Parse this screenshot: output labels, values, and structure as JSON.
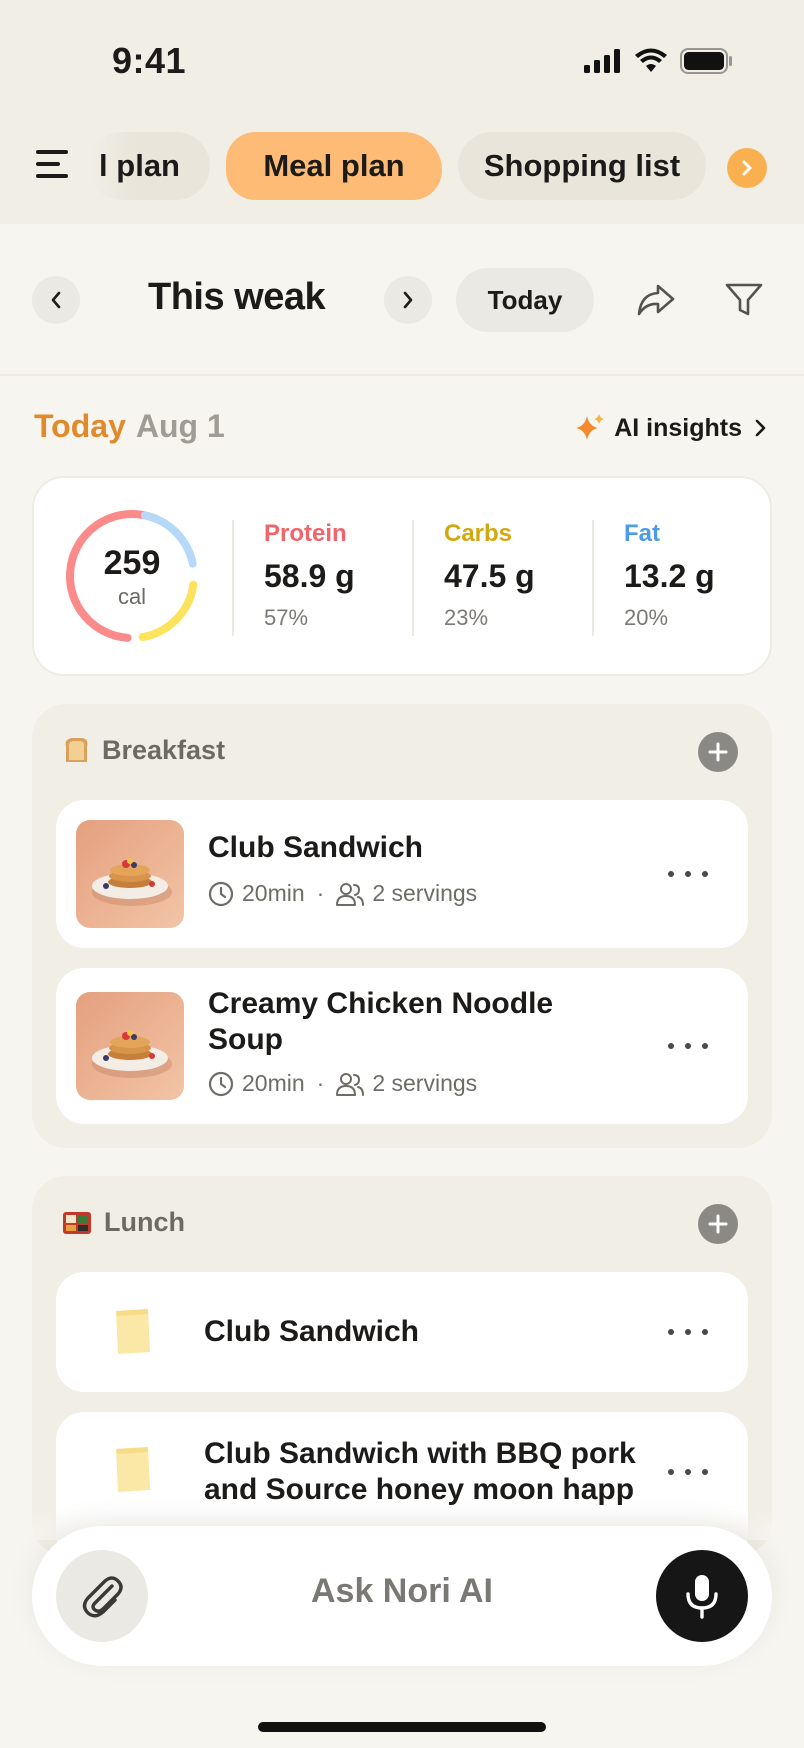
{
  "status_bar": {
    "time": "9:41"
  },
  "tabs": [
    {
      "label": "l plan"
    },
    {
      "label": "Meal plan",
      "active": true
    },
    {
      "label": "Shopping list"
    }
  ],
  "week_bar": {
    "title": "This weak",
    "today_button": "Today"
  },
  "day": {
    "today_label": "Today",
    "date": "Aug 1",
    "ai_insights": "AI insights"
  },
  "macros": {
    "calories": {
      "value": "259",
      "unit": "cal"
    },
    "items": [
      {
        "name": "Protein",
        "value": "58.9 g",
        "percent": "57%",
        "color": "#f0646a"
      },
      {
        "name": "Carbs",
        "value": "47.5 g",
        "percent": "23%",
        "color": "#d1a90f"
      },
      {
        "name": "Fat",
        "value": "13.2 g",
        "percent": "20%",
        "color": "#4d9be8"
      }
    ]
  },
  "breakfast": {
    "title": "Breakfast",
    "icon": "bread-icon",
    "recipes": [
      {
        "title": "Club Sandwich",
        "time": "20min",
        "servings": "2 servings"
      },
      {
        "title": "Creamy Chicken Noodle Soup",
        "time": "20min",
        "servings": "2 servings"
      }
    ]
  },
  "lunch": {
    "title": "Lunch",
    "icon": "bento-icon",
    "recipes": [
      {
        "title": "Club Sandwich"
      },
      {
        "title": "Club Sandwich with BBQ pork and Source honey moon happ"
      }
    ]
  },
  "ask_bar": {
    "placeholder": "Ask Nori AI"
  },
  "colors": {
    "accent": "#fdbb76",
    "today": "#e08a2b",
    "ring_protein": "#fb8b8b",
    "ring_carbs": "#fde35b",
    "ring_fat": "#b6d9f9"
  }
}
